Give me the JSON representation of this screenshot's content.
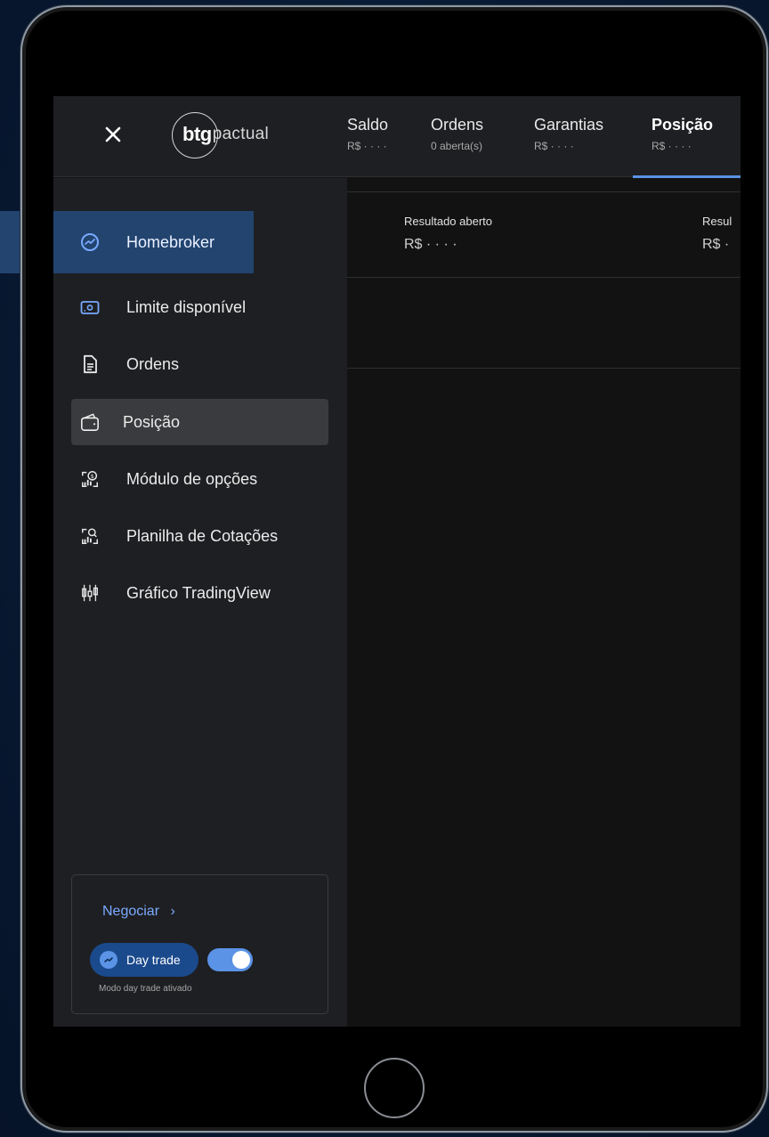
{
  "header": {
    "close_icon": "close-icon",
    "logo": {
      "bold": "btg",
      "light": "pactual"
    },
    "tabs": [
      {
        "label": "Saldo",
        "sub": "R$ · · · ·"
      },
      {
        "label": "Ordens",
        "sub": "0 aberta(s)"
      },
      {
        "label": "Garantias",
        "sub": "R$ · · · ·"
      },
      {
        "label": "Posição",
        "sub": "R$ · · · ·",
        "active": true
      }
    ]
  },
  "sidebar": {
    "items": [
      {
        "label": "Homebroker",
        "icon": "trend-up-circle-icon"
      },
      {
        "label": "Limite disponível",
        "icon": "cash-icon"
      },
      {
        "label": "Ordens",
        "icon": "document-icon"
      },
      {
        "label": "Posição",
        "icon": "wallet-icon",
        "selected": true
      },
      {
        "label": "Módulo de opções",
        "icon": "options-chart-icon"
      },
      {
        "label": "Planilha de Cotações",
        "icon": "quotes-chart-icon"
      },
      {
        "label": "Gráfico TradingView",
        "icon": "candlestick-icon"
      }
    ],
    "trade_card": {
      "negociar_label": "Negociar",
      "chevron": "›",
      "daytrade_label": "Day trade",
      "toggle_on": true,
      "status_text": "Modo day trade ativado"
    }
  },
  "main": {
    "metrics": [
      {
        "label": "Resultado aberto",
        "value": "R$ · · · ·"
      },
      {
        "label": "Resul",
        "value": "R$ ·"
      }
    ]
  },
  "colors": {
    "accent": "#5b93e6",
    "sidebar_bg": "#1e1f22",
    "highlight_band": "#22446f",
    "link": "#7aa9ff"
  }
}
